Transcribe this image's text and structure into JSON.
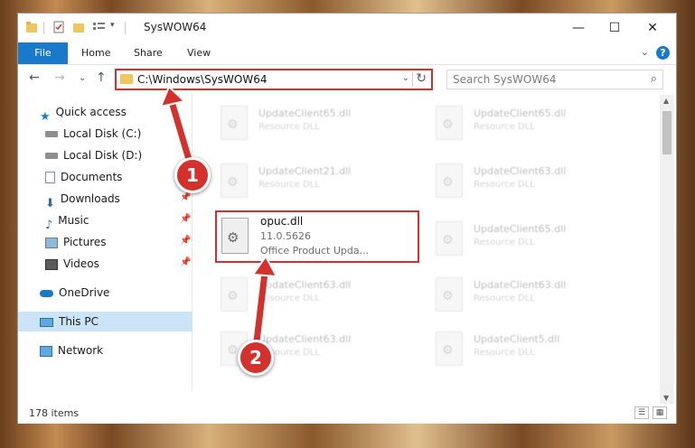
{
  "window": {
    "title": "SysWOW64",
    "minimize_label": "—",
    "maximize_label": "☐",
    "close_label": "✕"
  },
  "ribbon": {
    "tabs": [
      "File",
      "Home",
      "Share",
      "View"
    ],
    "help_label": "?",
    "collapse_label": "⌄"
  },
  "nav": {
    "back": "←",
    "forward": "→",
    "recent": "⌄",
    "up": "↑"
  },
  "address": {
    "path": "C:\\Windows\\SysWOW64",
    "dropdown": "⌄",
    "refresh": "↻"
  },
  "search": {
    "placeholder": "Search SysWOW64",
    "icon": "⌕"
  },
  "sidebar": {
    "items": [
      {
        "label": "Quick access",
        "icon": "star-icon",
        "pinned": false
      },
      {
        "label": "Local Disk (C:)",
        "icon": "drive-icon",
        "pinned": false
      },
      {
        "label": "Local Disk (D:)",
        "icon": "drive-icon",
        "pinned": false
      },
      {
        "label": "Documents",
        "icon": "documents-icon",
        "pinned": true
      },
      {
        "label": "Downloads",
        "icon": "downloads-icon",
        "pinned": true
      },
      {
        "label": "Music",
        "icon": "music-icon",
        "pinned": true
      },
      {
        "label": "Pictures",
        "icon": "pictures-icon",
        "pinned": true
      },
      {
        "label": "Videos",
        "icon": "videos-icon",
        "pinned": true
      },
      {
        "label": "OneDrive",
        "icon": "cloud-icon",
        "pinned": false
      },
      {
        "label": "This PC",
        "icon": "computer-icon",
        "pinned": false,
        "selected": true
      },
      {
        "label": "Network",
        "icon": "network-icon",
        "pinned": false
      }
    ]
  },
  "files": [
    {
      "name": "UpdateClient65.dll",
      "type": "Resource DLL"
    },
    {
      "name": "UpdateClient65.dll",
      "type": "Resource DLL"
    },
    {
      "name": "UpdateClient21.dll",
      "type": "Resource DLL"
    },
    {
      "name": "UpdateClient63.dll",
      "type": "Resource DLL"
    },
    {
      "name": "UpdateClient65.dll",
      "type": "Resource DLL"
    },
    {
      "name": "UpdateClient63.dll",
      "type": "Resource DLL"
    },
    {
      "name": "UpdateClient63.dll",
      "type": "Resource DLL"
    },
    {
      "name": "UpdateClient63.dll",
      "type": "Resource DLL"
    },
    {
      "name": "UpdateClient5.dll",
      "type": "Resource DLL"
    }
  ],
  "selected_file": {
    "name": "opuc.dll",
    "version": "11.0.5626",
    "description": "Office Product Upda..."
  },
  "status": {
    "item_count": "178 items"
  },
  "annotations": {
    "marker_1": "1",
    "marker_2": "2",
    "color": "#d3312c"
  },
  "colors": {
    "accent": "#1979ca",
    "highlight": "#d32f2f",
    "selected_nav": "#cce4f7"
  }
}
